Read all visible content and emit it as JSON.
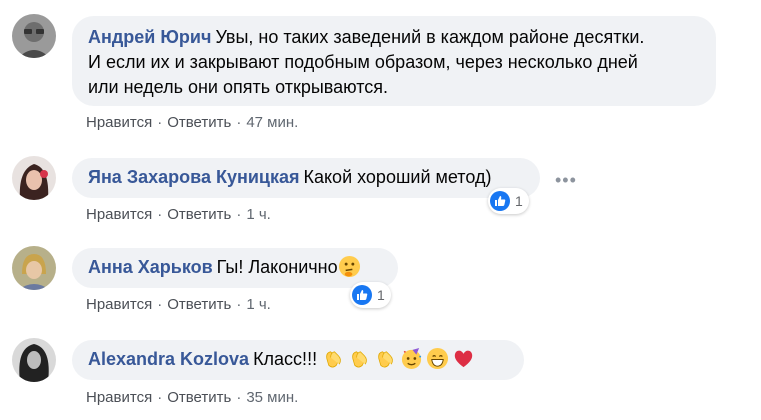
{
  "comments": [
    {
      "author": "Андрей Юрич",
      "text": "Увы, но таких заведений в каждом районе десятки. И если их и закрывают подобным образом, через несколько дней или недель они опять открываются.",
      "line1": "Увы, но таких заведений в каждом районе десятки.",
      "line2": "И если их и закрывают подобным образом, через несколько дней",
      "line3": "или недель они опять открываются.",
      "like_label": "Нравится",
      "reply_label": "Ответить",
      "time": "47 мин."
    },
    {
      "author": "Яна Захарова Куницкая",
      "text": "Какой хороший метод)",
      "like_label": "Нравится",
      "reply_label": "Ответить",
      "time": "1 ч.",
      "reaction_count": "1"
    },
    {
      "author": "Анна Харьков",
      "text": "Гы! Лаконично",
      "like_label": "Нравится",
      "reply_label": "Ответить",
      "time": "1 ч.",
      "reaction_count": "1",
      "emoji": "thinking-face-icon"
    },
    {
      "author": "Alexandra Kozlova",
      "text": "Класс!!!",
      "like_label": "Нравится",
      "reply_label": "Ответить",
      "time": "35 мин.",
      "emojis": [
        "clapping-hands-icon",
        "clapping-hands-icon",
        "clapping-hands-icon",
        "partying-face-icon",
        "grinning-face-icon",
        "red-heart-icon"
      ]
    }
  ],
  "separator": "·",
  "more_icon": "more-options-icon",
  "colors": {
    "author": "#385898",
    "bubble": "#f0f2f5",
    "like_blue": "#1877f2",
    "meta": "#606770"
  }
}
